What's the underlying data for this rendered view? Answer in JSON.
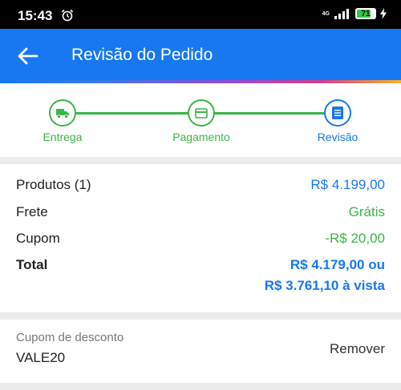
{
  "status_bar": {
    "time": "15:43",
    "network": "4G",
    "battery_level": "71"
  },
  "app_bar": {
    "title": "Revisão do Pedido",
    "back_icon": "arrow-left-icon"
  },
  "stepper": {
    "steps": [
      {
        "label": "Entrega",
        "icon": "truck-icon",
        "color": "#3bb44a"
      },
      {
        "label": "Pagamento",
        "icon": "credit-card-icon",
        "color": "#3bb44a"
      },
      {
        "label": "Revisão",
        "icon": "document-icon",
        "color": "#1778f2"
      }
    ]
  },
  "summary": {
    "products_label": "Produtos (1)",
    "products_value": "R$ 4.199,00",
    "shipping_label": "Frete",
    "shipping_value": "Grátis",
    "coupon_label": "Cupom",
    "coupon_value": "-R$ 20,00",
    "total_label": "Total",
    "total_value": "R$ 4.179,00 ou",
    "total_cash_value": "R$ 3.761,10 à vista"
  },
  "coupon": {
    "label": "Cupom de desconto",
    "code": "VALE20",
    "remove_label": "Remover"
  },
  "colors": {
    "primary": "#1778f2",
    "success": "#3bb44a"
  }
}
